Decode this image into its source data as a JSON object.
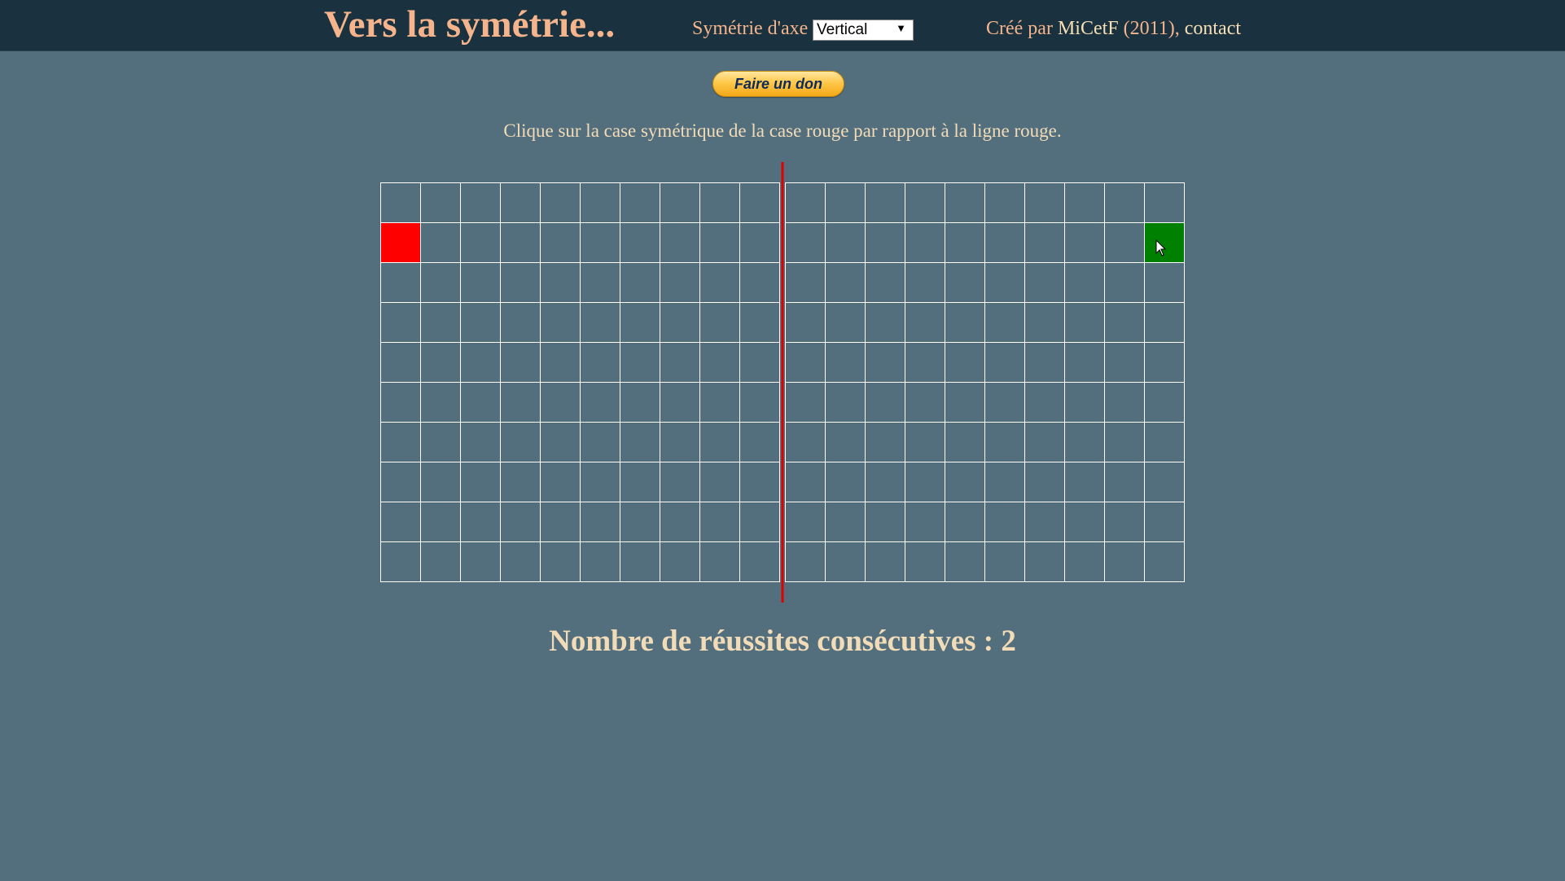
{
  "header": {
    "title": "Vers la symétrie...",
    "axis_label": "Symétrie d'axe",
    "axis_select": {
      "selected": "Vertical"
    },
    "credits_prefix": "Créé par ",
    "author": "MiCetF",
    "year": " (2011), ",
    "contact": "contact"
  },
  "donate_label": "Faire un don",
  "instructions": "Clique sur la case symétrique de la case rouge par rapport à la ligne rouge.",
  "board": {
    "columns": 20,
    "rows": 10,
    "axis_after_column": 10,
    "red_cell": {
      "row": 2,
      "column": 1
    },
    "green_cell": {
      "row": 2,
      "column": 20
    },
    "colors": {
      "grid_line": "#ffffff",
      "cell": "#536e7d",
      "axis": "#e00000",
      "red": "#ff0000",
      "green": "#008000"
    }
  },
  "score_text": "Nombre de réussites consécutives : 2"
}
